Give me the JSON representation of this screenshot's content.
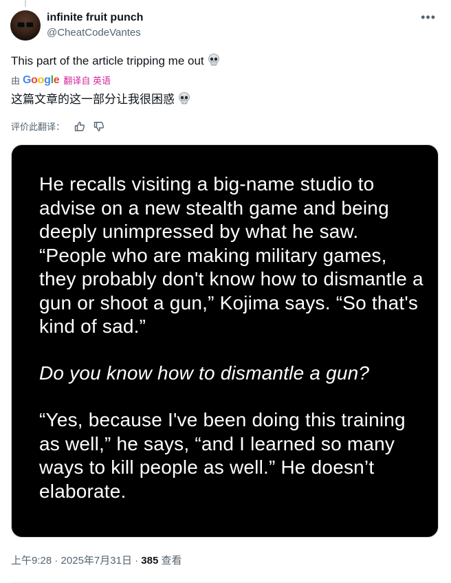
{
  "author": {
    "display_name": "infinite fruit punch",
    "handle": "@CheatCodeVantes"
  },
  "post": {
    "text": "This part of the article tripping me out",
    "emoji": "skull-emoji"
  },
  "translation": {
    "by_label": "由",
    "google": [
      "G",
      "o",
      "o",
      "g",
      "l",
      "e"
    ],
    "link_label": "翻译自 英语",
    "translated_text": "这篇文章的这一部分让我很困惑",
    "rate_label": "评价此翻译："
  },
  "media": {
    "paragraph_1": "He recalls visiting a big-name studio to advise on a new stealth game and being deeply unimpressed by what he saw. “People who are making military games, they probably don't know how to dismantle a gun or shoot a gun,” Kojima says. “So that's kind of sad.”",
    "question": "Do you know how to dismantle a gun?",
    "paragraph_2": "“Yes, because I've been doing this training as well,” he says, “and I learned so many ways to kill people as well.” He doesn’t elaborate."
  },
  "meta": {
    "time": "上午9:28",
    "separator": " · ",
    "date": "2025年7月31日",
    "views_count": "385",
    "views_label": "查看"
  },
  "icons": {
    "more": "more-horizontal-icon",
    "thumbs_up": "thumbs-up-icon",
    "thumbs_down": "thumbs-down-icon"
  }
}
